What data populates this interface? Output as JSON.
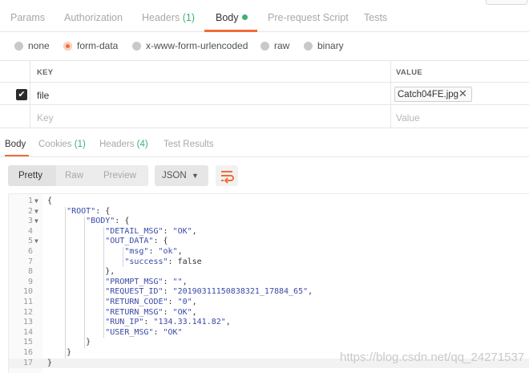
{
  "request_tabs": [
    {
      "label": "Params",
      "count": ""
    },
    {
      "label": "Authorization",
      "count": ""
    },
    {
      "label": "Headers ",
      "count": "(1)"
    },
    {
      "label": "Body",
      "count": ""
    },
    {
      "label": "Pre-request Script",
      "count": ""
    },
    {
      "label": "Tests",
      "count": ""
    }
  ],
  "body_types": [
    {
      "label": "none",
      "selected": false
    },
    {
      "label": "form-data",
      "selected": true
    },
    {
      "label": "x-www-form-urlencoded",
      "selected": false
    },
    {
      "label": "raw",
      "selected": false
    },
    {
      "label": "binary",
      "selected": false
    }
  ],
  "kv_table": {
    "headers": {
      "key": "KEY",
      "value": "VALUE"
    },
    "rows": [
      {
        "checked": true,
        "key": "file",
        "value": "Catch04FE.jpg"
      }
    ],
    "placeholder": {
      "key": "Key",
      "value": "Value"
    }
  },
  "response_tabs": [
    {
      "label": "Body",
      "count": ""
    },
    {
      "label": "Cookies ",
      "count": "(1)"
    },
    {
      "label": "Headers ",
      "count": "(4)"
    },
    {
      "label": "Test Results",
      "count": ""
    }
  ],
  "format_buttons": [
    "Pretty",
    "Raw",
    "Preview"
  ],
  "format_select": "JSON",
  "colors": {
    "accent": "#f26b3a",
    "count": "#3bb273",
    "json": "#3a4aa8"
  },
  "code_lines": [
    {
      "n": "1",
      "fold": true,
      "text": "{"
    },
    {
      "n": "2",
      "fold": true,
      "text": "    \"ROOT\": {"
    },
    {
      "n": "3",
      "fold": true,
      "text": "        \"BODY\": {"
    },
    {
      "n": "4",
      "fold": false,
      "text": "            \"DETAIL_MSG\": \"OK\","
    },
    {
      "n": "5",
      "fold": true,
      "text": "            \"OUT_DATA\": {"
    },
    {
      "n": "6",
      "fold": false,
      "text": "                \"msg\": \"ok\","
    },
    {
      "n": "7",
      "fold": false,
      "text": "                \"success\": false"
    },
    {
      "n": "8",
      "fold": false,
      "text": "            },"
    },
    {
      "n": "9",
      "fold": false,
      "text": "            \"PROMPT_MSG\": \"\","
    },
    {
      "n": "10",
      "fold": false,
      "text": "            \"REQUEST_ID\": \"20190311150838321_17884_65\","
    },
    {
      "n": "11",
      "fold": false,
      "text": "            \"RETURN_CODE\": \"0\","
    },
    {
      "n": "12",
      "fold": false,
      "text": "            \"RETURN_MSG\": \"OK\","
    },
    {
      "n": "13",
      "fold": false,
      "text": "            \"RUN_IP\": \"134.33.141.82\","
    },
    {
      "n": "14",
      "fold": false,
      "text": "            \"USER_MSG\": \"OK\""
    },
    {
      "n": "15",
      "fold": false,
      "text": "        }"
    },
    {
      "n": "16",
      "fold": false,
      "text": "    }"
    },
    {
      "n": "17",
      "fold": false,
      "text": "}"
    }
  ],
  "watermark": "https://blog.csdn.net/qq_24271537"
}
